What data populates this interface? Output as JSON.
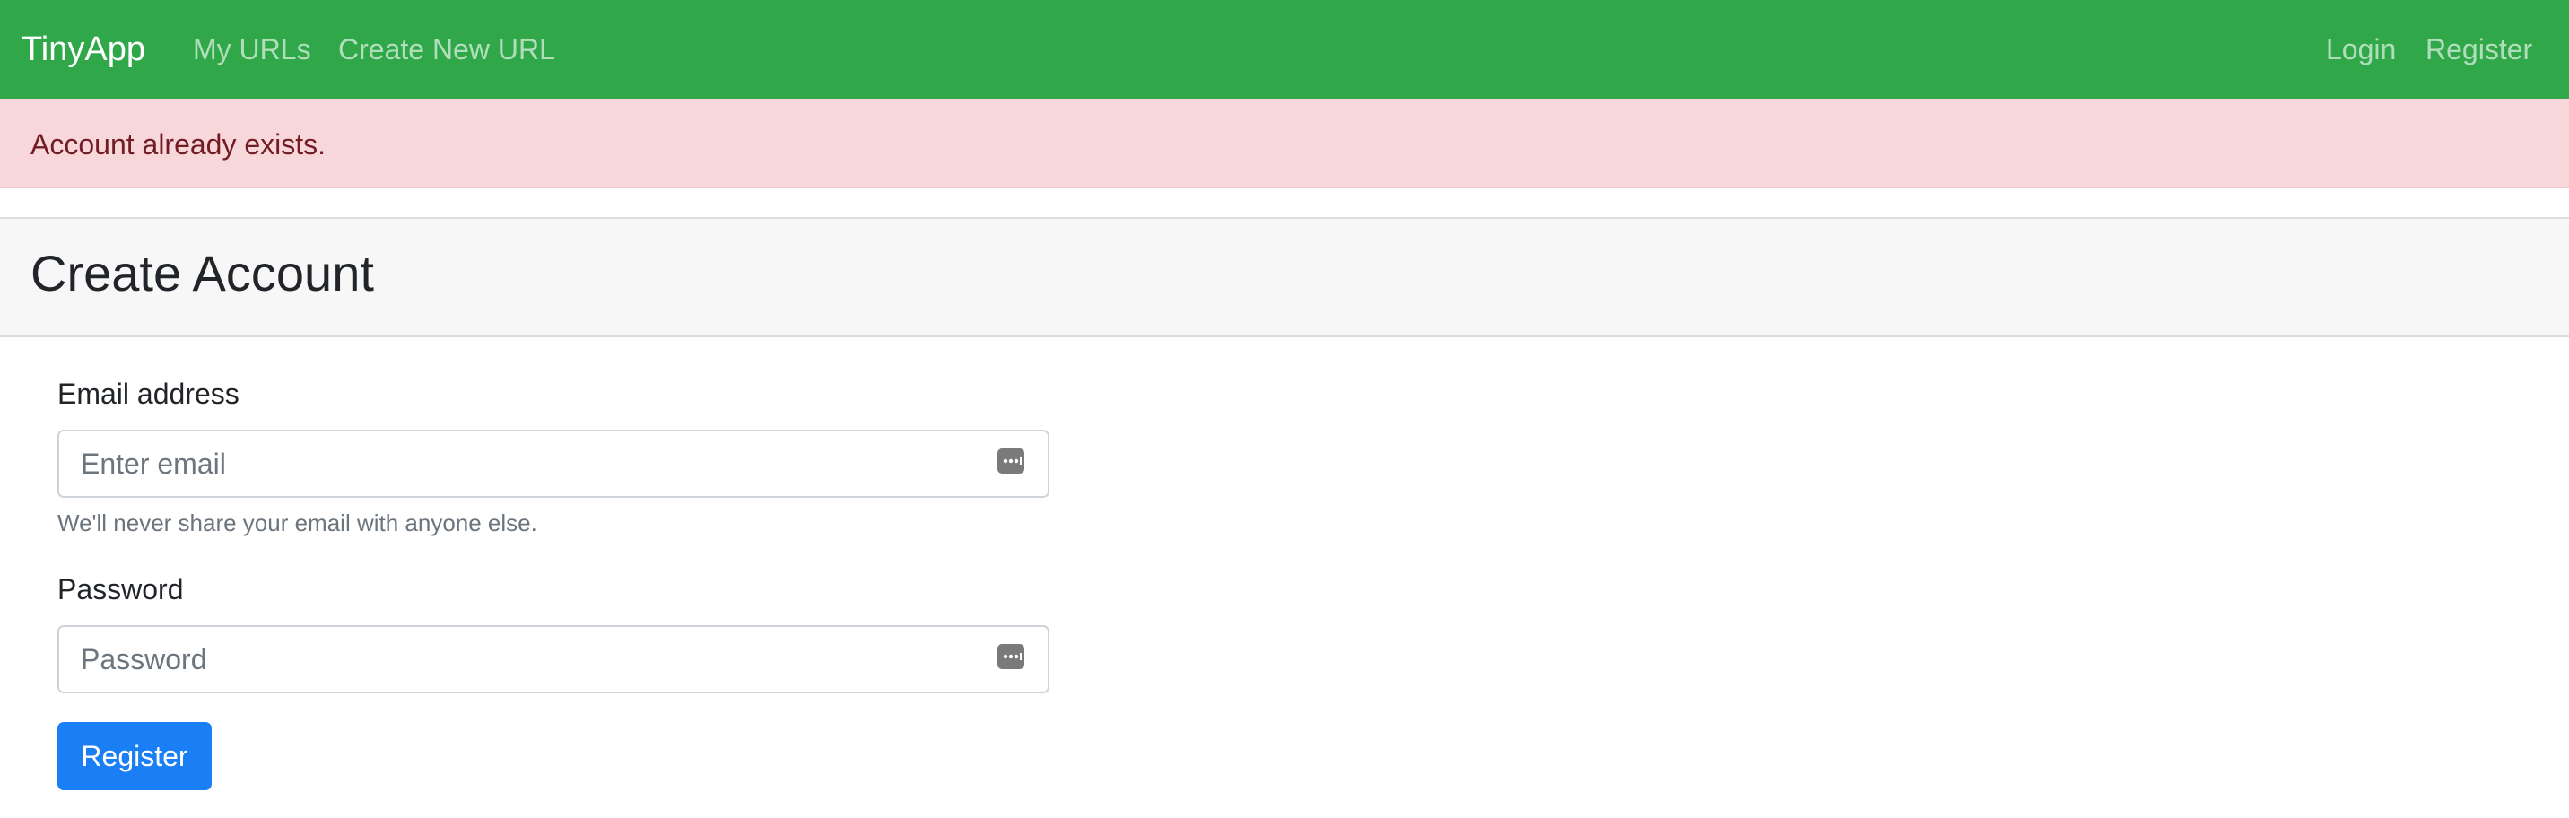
{
  "navbar": {
    "brand": "TinyApp",
    "links": [
      "My URLs",
      "Create New URL"
    ],
    "right_links": [
      "Login",
      "Register"
    ],
    "background_color": "#30a84a"
  },
  "alert": {
    "message": "Account already exists.",
    "background_color": "#f8d7da",
    "text_color": "#721c24"
  },
  "page": {
    "title": "Create Account"
  },
  "form": {
    "email": {
      "label": "Email address",
      "placeholder": "Enter email",
      "value": "",
      "help": "We'll never share your email with anyone else.",
      "icon": "password-manager-key-icon"
    },
    "password": {
      "label": "Password",
      "placeholder": "Password",
      "value": "",
      "icon": "password-manager-key-icon"
    },
    "submit_label": "Register",
    "submit_color": "#1a7ff5"
  }
}
